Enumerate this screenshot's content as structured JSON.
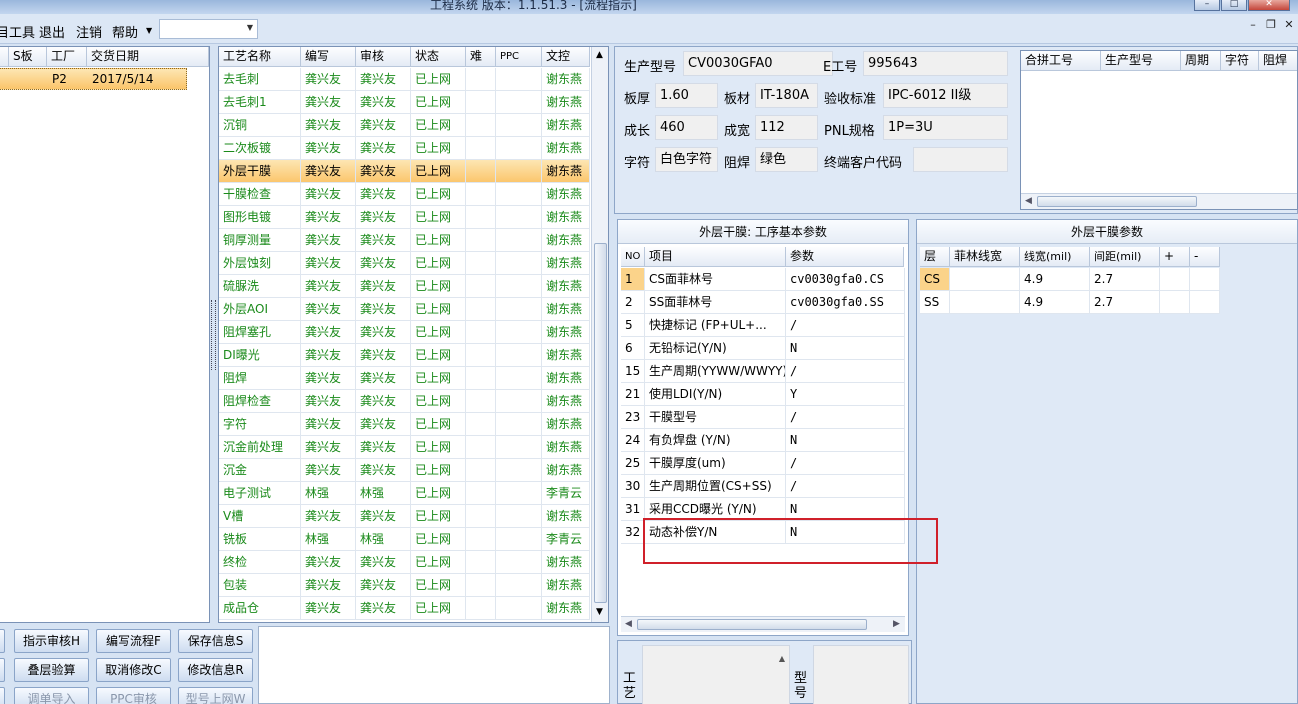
{
  "title": {
    "text": "工程系统   版本：1.1.51.3 - [流程指示]"
  },
  "menu": [
    {
      "label": "目工具"
    },
    {
      "label": "退出"
    },
    {
      "label": "注销"
    },
    {
      "label": "帮助"
    }
  ],
  "left_grid": {
    "headers": [
      "S板",
      "工厂",
      "交货日期"
    ],
    "row": {
      "factory": "P2",
      "date": "2017/5/14"
    }
  },
  "process_grid": {
    "headers": [
      "工艺名称",
      "编写",
      "审核",
      "状态",
      "难",
      "PPC",
      "文控"
    ],
    "rows": [
      {
        "name": "去毛刺",
        "writer": "龚兴友",
        "reviewer": "龚兴友",
        "status": "已上网",
        "doc": "谢东燕"
      },
      {
        "name": "去毛刺1",
        "writer": "龚兴友",
        "reviewer": "龚兴友",
        "status": "已上网",
        "doc": "谢东燕"
      },
      {
        "name": "沉铜",
        "writer": "龚兴友",
        "reviewer": "龚兴友",
        "status": "已上网",
        "doc": "谢东燕"
      },
      {
        "name": "二次板镀",
        "writer": "龚兴友",
        "reviewer": "龚兴友",
        "status": "已上网",
        "doc": "谢东燕"
      },
      {
        "name": "外层干膜",
        "writer": "龚兴友",
        "reviewer": "龚兴友",
        "status": "已上网",
        "doc": "谢东燕"
      },
      {
        "name": "干膜检查",
        "writer": "龚兴友",
        "reviewer": "龚兴友",
        "status": "已上网",
        "doc": "谢东燕"
      },
      {
        "name": "图形电镀",
        "writer": "龚兴友",
        "reviewer": "龚兴友",
        "status": "已上网",
        "doc": "谢东燕"
      },
      {
        "name": "铜厚测量",
        "writer": "龚兴友",
        "reviewer": "龚兴友",
        "status": "已上网",
        "doc": "谢东燕"
      },
      {
        "name": "外层蚀刻",
        "writer": "龚兴友",
        "reviewer": "龚兴友",
        "status": "已上网",
        "doc": "谢东燕"
      },
      {
        "name": "硫脲洗",
        "writer": "龚兴友",
        "reviewer": "龚兴友",
        "status": "已上网",
        "doc": "谢东燕"
      },
      {
        "name": "外层AOI",
        "writer": "龚兴友",
        "reviewer": "龚兴友",
        "status": "已上网",
        "doc": "谢东燕"
      },
      {
        "name": "阻焊塞孔",
        "writer": "龚兴友",
        "reviewer": "龚兴友",
        "status": "已上网",
        "doc": "谢东燕"
      },
      {
        "name": "DI曝光",
        "writer": "龚兴友",
        "reviewer": "龚兴友",
        "status": "已上网",
        "doc": "谢东燕"
      },
      {
        "name": "阻焊",
        "writer": "龚兴友",
        "reviewer": "龚兴友",
        "status": "已上网",
        "doc": "谢东燕"
      },
      {
        "name": "阻焊检查",
        "writer": "龚兴友",
        "reviewer": "龚兴友",
        "status": "已上网",
        "doc": "谢东燕"
      },
      {
        "name": "字符",
        "writer": "龚兴友",
        "reviewer": "龚兴友",
        "status": "已上网",
        "doc": "谢东燕"
      },
      {
        "name": "沉金前处理",
        "writer": "龚兴友",
        "reviewer": "龚兴友",
        "status": "已上网",
        "doc": "谢东燕"
      },
      {
        "name": "沉金",
        "writer": "龚兴友",
        "reviewer": "龚兴友",
        "status": "已上网",
        "doc": "谢东燕"
      },
      {
        "name": "电子测试",
        "writer": "林强",
        "reviewer": "林强",
        "status": "已上网",
        "doc": "李青云"
      },
      {
        "name": "V槽",
        "writer": "龚兴友",
        "reviewer": "龚兴友",
        "status": "已上网",
        "doc": "谢东燕"
      },
      {
        "name": "铣板",
        "writer": "林强",
        "reviewer": "林强",
        "status": "已上网",
        "doc": "李青云"
      },
      {
        "name": "终检",
        "writer": "龚兴友",
        "reviewer": "龚兴友",
        "status": "已上网",
        "doc": "谢东燕"
      },
      {
        "name": "包装",
        "writer": "龚兴友",
        "reviewer": "龚兴友",
        "status": "已上网",
        "doc": "谢东燕"
      },
      {
        "name": "成品仓",
        "writer": "龚兴友",
        "reviewer": "龚兴友",
        "status": "已上网",
        "doc": "谢东燕"
      }
    ]
  },
  "buttons": [
    {
      "label": "指示审核H"
    },
    {
      "label": "编写流程F"
    },
    {
      "label": "保存信息S"
    },
    {
      "label": "叠层验算"
    },
    {
      "label": "取消修改C"
    },
    {
      "label": "修改信息R"
    },
    {
      "label": "调单导入"
    },
    {
      "label": "PPC审核"
    },
    {
      "label": "型号上网W"
    }
  ],
  "info": {
    "model_label": "生产型号",
    "model_value": "CV0030GFA0",
    "eng_label": "E工号",
    "eng_value": "995643",
    "thickness_label": "板厚",
    "thickness_value": "1.60",
    "material_label": "板材",
    "material_value": "IT-180A",
    "standard_label": "验收标准",
    "standard_value": "IPC-6012 II级",
    "length_label": "成长",
    "length_value": "460",
    "width_label": "成宽",
    "width_value": "112",
    "pnl_label": "PNL规格",
    "pnl_value": "1P=3U",
    "char_label": "字符",
    "char_value": "白色字符",
    "mask_label": "阻焊",
    "mask_value": "绿色",
    "customer_label": "终端客户代码",
    "customer_value": ""
  },
  "merge_grid": {
    "headers": [
      "合拼工号",
      "生产型号",
      "周期",
      "字符",
      "阻焊"
    ]
  },
  "params": {
    "title": "外层干膜: 工序基本参数",
    "headers": [
      "NO",
      "项目",
      "参数"
    ],
    "rows": [
      {
        "no": "1",
        "item": "CS面菲林号",
        "value": "cv0030gfa0.CS"
      },
      {
        "no": "2",
        "item": "SS面菲林号",
        "value": "cv0030gfa0.SS"
      },
      {
        "no": "5",
        "item": "快捷标记 (FP+UL+...",
        "value": "/"
      },
      {
        "no": "6",
        "item": "无铅标记(Y/N)",
        "value": "N"
      },
      {
        "no": "15",
        "item": "生产周期(YYWW/WWYY)",
        "value": "/"
      },
      {
        "no": "21",
        "item": "使用LDI(Y/N)",
        "value": "Y"
      },
      {
        "no": "23",
        "item": "干膜型号",
        "value": "/"
      },
      {
        "no": "24",
        "item": "有负焊盘 (Y/N)",
        "value": "N"
      },
      {
        "no": "25",
        "item": "干膜厚度(um)",
        "value": "/"
      },
      {
        "no": "30",
        "item": "生产周期位置(CS+SS)",
        "value": "/"
      },
      {
        "no": "31",
        "item": "采用CCD曝光 (Y/N)",
        "value": "N"
      },
      {
        "no": "32",
        "item": "动态补偿Y/N",
        "value": "N"
      }
    ]
  },
  "dryfilm": {
    "title": "外层干膜参数",
    "headers": [
      "层",
      "菲林线宽",
      "线宽(mil)",
      "间距(mil)",
      "+",
      "-"
    ],
    "rows": [
      {
        "layer": "CS",
        "film": "",
        "width": "4.9",
        "gap": "2.7"
      },
      {
        "layer": "SS",
        "film": "",
        "width": "4.9",
        "gap": "2.7"
      }
    ]
  },
  "bottom": {
    "process_label": "工艺",
    "model_label": "型号"
  }
}
